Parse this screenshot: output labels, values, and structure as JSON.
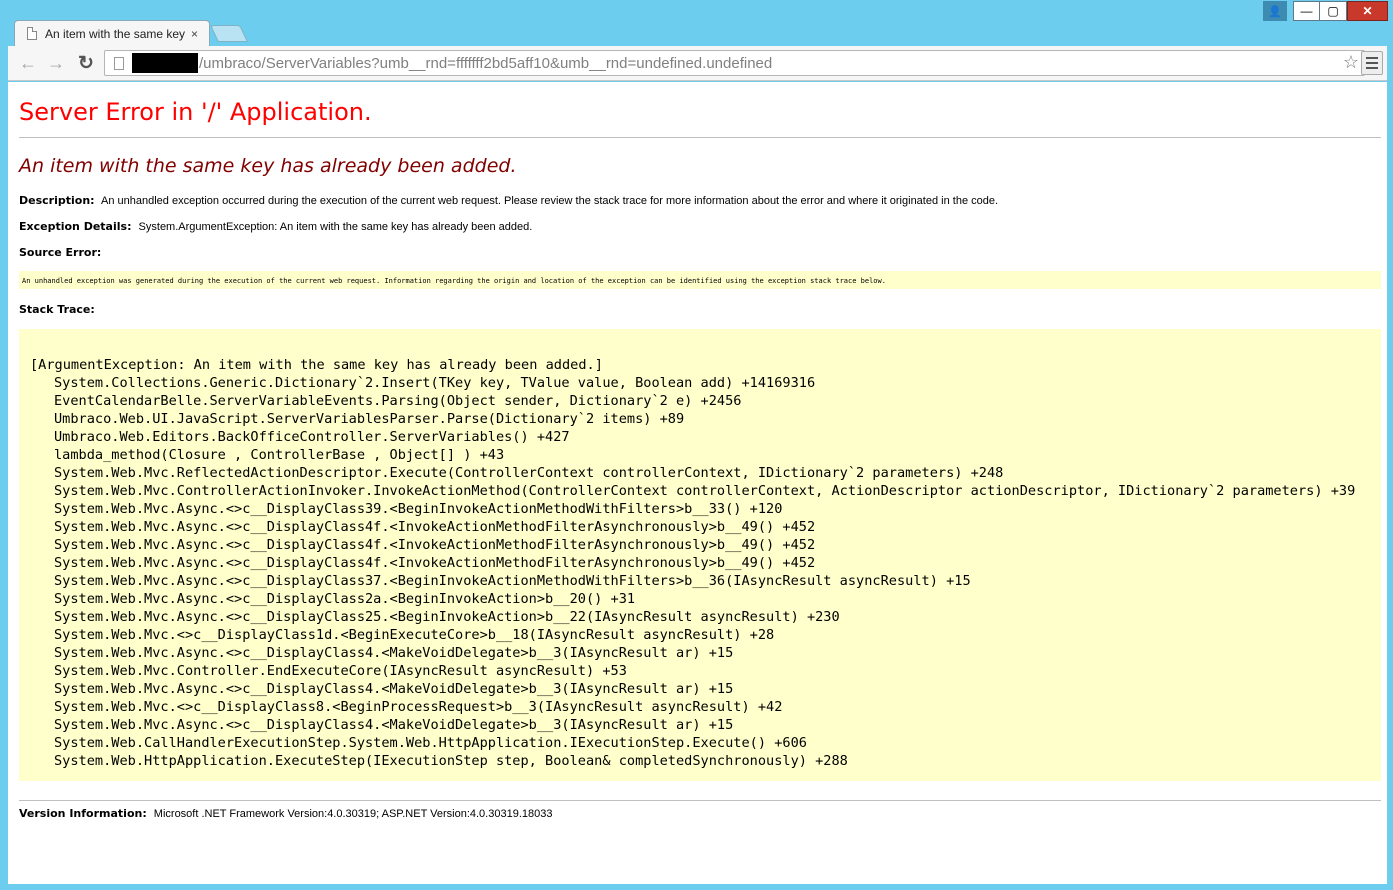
{
  "browser": {
    "tab_title": "An item with the same key",
    "tab_close": "×",
    "url": "/umbraco/ServerVariables?umb__rnd=fffffff2bd5aff10&umb__rnd=undefined.undefined",
    "back_glyph": "←",
    "forward_glyph": "→",
    "reload_glyph": "↻",
    "star_glyph": "☆",
    "window_buttons": {
      "user": "👤",
      "minimize": "—",
      "maximize": "▢",
      "close": "✕"
    }
  },
  "page": {
    "title": "Server Error in '/' Application.",
    "error_heading": "An item with the same key has already been added.",
    "description_label": "Description:",
    "description_text": "An unhandled exception occurred during the execution of the current web request. Please review the stack trace for more information about the error and where it originated in the code.",
    "exception_label": "Exception Details:",
    "exception_text": "System.ArgumentException: An item with the same key has already been added.",
    "source_error_label": "Source Error:",
    "source_error_text": "An unhandled exception was generated during the execution of the current web request. Information regarding the origin and location of the exception can be identified using the exception stack trace below.",
    "stack_trace_label": "Stack Trace:",
    "stack_header": "[ArgumentException: An item with the same key has already been added.]",
    "stack_lines": [
      "System.Collections.Generic.Dictionary`2.Insert(TKey key, TValue value, Boolean add) +14169316",
      "EventCalendarBelle.ServerVariableEvents.Parsing(Object sender, Dictionary`2 e) +2456",
      "Umbraco.Web.UI.JavaScript.ServerVariablesParser.Parse(Dictionary`2 items) +89",
      "Umbraco.Web.Editors.BackOfficeController.ServerVariables() +427",
      "lambda_method(Closure , ControllerBase , Object[] ) +43",
      "System.Web.Mvc.ReflectedActionDescriptor.Execute(ControllerContext controllerContext, IDictionary`2 parameters) +248",
      "System.Web.Mvc.ControllerActionInvoker.InvokeActionMethod(ControllerContext controllerContext, ActionDescriptor actionDescriptor, IDictionary`2 parameters) +39",
      "System.Web.Mvc.Async.<>c__DisplayClass39.<BeginInvokeActionMethodWithFilters>b__33() +120",
      "System.Web.Mvc.Async.<>c__DisplayClass4f.<InvokeActionMethodFilterAsynchronously>b__49() +452",
      "System.Web.Mvc.Async.<>c__DisplayClass4f.<InvokeActionMethodFilterAsynchronously>b__49() +452",
      "System.Web.Mvc.Async.<>c__DisplayClass4f.<InvokeActionMethodFilterAsynchronously>b__49() +452",
      "System.Web.Mvc.Async.<>c__DisplayClass37.<BeginInvokeActionMethodWithFilters>b__36(IAsyncResult asyncResult) +15",
      "System.Web.Mvc.Async.<>c__DisplayClass2a.<BeginInvokeAction>b__20() +31",
      "System.Web.Mvc.Async.<>c__DisplayClass25.<BeginInvokeAction>b__22(IAsyncResult asyncResult) +230",
      "System.Web.Mvc.<>c__DisplayClass1d.<BeginExecuteCore>b__18(IAsyncResult asyncResult) +28",
      "System.Web.Mvc.Async.<>c__DisplayClass4.<MakeVoidDelegate>b__3(IAsyncResult ar) +15",
      "System.Web.Mvc.Controller.EndExecuteCore(IAsyncResult asyncResult) +53",
      "System.Web.Mvc.Async.<>c__DisplayClass4.<MakeVoidDelegate>b__3(IAsyncResult ar) +15",
      "System.Web.Mvc.<>c__DisplayClass8.<BeginProcessRequest>b__3(IAsyncResult asyncResult) +42",
      "System.Web.Mvc.Async.<>c__DisplayClass4.<MakeVoidDelegate>b__3(IAsyncResult ar) +15",
      "System.Web.CallHandlerExecutionStep.System.Web.HttpApplication.IExecutionStep.Execute() +606",
      "System.Web.HttpApplication.ExecuteStep(IExecutionStep step, Boolean& completedSynchronously) +288"
    ],
    "version_label": "Version Information:",
    "version_text": "Microsoft .NET Framework Version:4.0.30319; ASP.NET Version:4.0.30319.18033"
  },
  "colors": {
    "title_red": "#ff0000",
    "heading_maroon": "#800000",
    "code_background": "#ffffcc",
    "window_frame": "#6ccdee"
  }
}
